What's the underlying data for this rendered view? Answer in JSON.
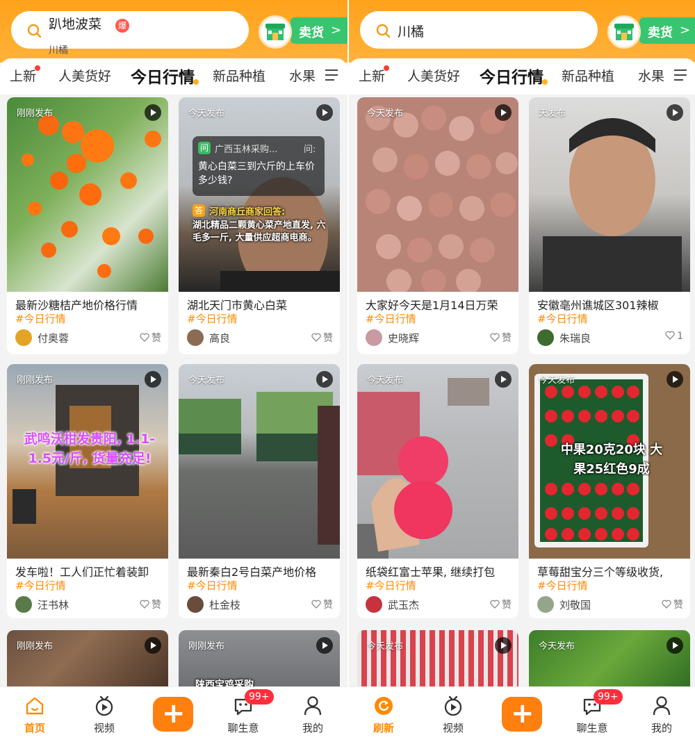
{
  "panels": [
    {
      "search": {
        "current": "趴地波菜",
        "hot_badge": "爆",
        "next": "川橘"
      },
      "sell_button": {
        "label": "卖货",
        "arrow": ">"
      },
      "tabs": [
        "上新",
        "人美货好",
        "今日行情",
        "新品种植",
        "水果"
      ],
      "cards": [
        {
          "badge": "刚刚发布",
          "title": "最新沙糖桔产地价格行情",
          "tag": "#今日行情",
          "author": "付奥蓉",
          "like": "赞"
        },
        {
          "badge": "今天发布",
          "title": "湖北天门市黄心白菜",
          "tag": "#今日行情",
          "author": "高良",
          "like": "赞",
          "overlay": {
            "q_prefix": "问",
            "q_from": "广西玉林采购...",
            "q_tail": "问:",
            "question": "黄心白菜三到六斤的上车价多少钱?",
            "a_prefix": "答",
            "a_from": "河南商丘商家回答:",
            "answer": "湖北精品二颗黄心菜产地直发, 六毛多一斤, 大量供应超商电商。"
          }
        },
        {
          "badge": "刚刚发布",
          "title": "发车啦！工人们正忙着装卸",
          "tag": "#今日行情",
          "author": "汪书林",
          "like": "赞",
          "overlay_text": "武鸣沃柑发贵阳, 1.1-1.5元/斤, 货量充足!"
        },
        {
          "badge": "今天发布",
          "title": "最新秦白2号白菜产地价格",
          "tag": "#今日行情",
          "author": "杜金枝",
          "like": "赞"
        },
        {
          "badge": "刚刚发布"
        },
        {
          "badge": "刚刚发布",
          "overlay_partial": "陕西宝鸡采购"
        }
      ],
      "tabbar": {
        "home": "首页",
        "video": "视频",
        "plus": "+",
        "chat": "聊生意",
        "chat_badge": "99+",
        "me": "我的"
      }
    },
    {
      "search": {
        "current": "川橘"
      },
      "sell_button": {
        "label": "卖货",
        "arrow": ">"
      },
      "tabs": [
        "上新",
        "人美货好",
        "今日行情",
        "新品种植",
        "水果"
      ],
      "cards": [
        {
          "badge": "今天发布",
          "title": "大家好今天是1月14日万荣",
          "tag": "#今日行情",
          "author": "史晓辉",
          "like": "赞"
        },
        {
          "badge": "天发布",
          "title": "安徽亳州谯城区301辣椒",
          "tag": "#今日行情",
          "author": "朱瑞良",
          "like": "1"
        },
        {
          "badge": "今天发布",
          "title": "纸袋红富士苹果, 继续打包",
          "tag": "#今日行情",
          "author": "武玉杰",
          "like": "赞"
        },
        {
          "badge": "今天发布",
          "title": "草莓甜宝分三个等级收货,",
          "tag": "#今日行情",
          "author": "刘敬国",
          "like": "赞",
          "overlay_text": "中果20克20块 大果25红色9成"
        },
        {
          "badge": "今天发布"
        },
        {
          "badge": "今天发布"
        }
      ],
      "tabbar": {
        "home": "刷新",
        "video": "视频",
        "plus": "+",
        "chat": "聊生意",
        "chat_badge": "99+",
        "me": "我的"
      }
    }
  ],
  "colors": {
    "accent": "#ff8a00",
    "header": "#ffa21b",
    "sell": "#38c56f",
    "badge_red": "#ff2e3c"
  }
}
